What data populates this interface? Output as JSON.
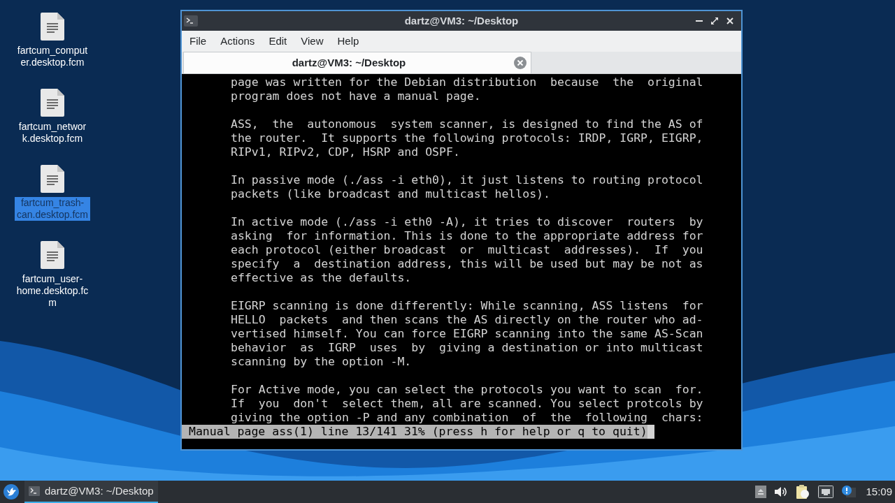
{
  "desktop_icons": [
    {
      "label_lines": [
        "fartcum_comput",
        "er.desktop.fcm"
      ],
      "selected": false
    },
    {
      "label_lines": [
        "fartcum_networ",
        "k.desktop.fcm"
      ],
      "selected": false
    },
    {
      "label_lines": [
        "fartcum_trash-",
        "can.desktop.fcm"
      ],
      "selected": true
    },
    {
      "label_lines": [
        "fartcum_user-",
        "home.desktop.fc",
        "m"
      ],
      "selected": false
    }
  ],
  "window": {
    "title": "dartz@VM3: ~/Desktop",
    "menu": [
      "File",
      "Actions",
      "Edit",
      "View",
      "Help"
    ],
    "tabs": [
      {
        "label": "dartz@VM3: ~/Desktop",
        "selected": true
      }
    ],
    "terminal": {
      "paragraphs": [
        [
          "page was written for the Debian distribution  because  the  original",
          "program does not have a manual page."
        ],
        [
          "ASS,  the  autonomous  system scanner, is designed to find the AS of",
          "the router.  It supports the following protocols: IRDP, IGRP, EIGRP,",
          "RIPv1, RIPv2, CDP, HSRP and OSPF."
        ],
        [
          "In passive mode (./ass -i eth0), it just listens to routing protocol",
          "packets (like broadcast and multicast hellos)."
        ],
        [
          "In active mode (./ass -i eth0 -A), it tries to discover  routers  by",
          "asking  for information. This is done to the appropriate address for",
          "each protocol (either broadcast  or  multicast  addresses).  If  you",
          "specify  a  destination address, this will be used but may be not as",
          "effective as the defaults."
        ],
        [
          "EIGRP scanning is done differently: While scanning, ASS listens  for",
          "HELLO  packets  and then scans the AS directly on the router who ad-",
          "vertised himself. You can force EIGRP scanning into the same AS-Scan",
          "behavior  as  IGRP  uses  by  giving a destination or into multicast",
          "scanning by the option -M."
        ],
        [
          "For Active mode, you can select the protocols you want to scan  for.",
          "If  you  don't  select them, all are scanned. You select protcols by",
          "giving the option -P and any combination  of  the  following  chars:"
        ]
      ],
      "status_line": "Manual page ass(1) line 13/141 31% (press h for help or q to quit)"
    }
  },
  "taskbar": {
    "tasks": [
      {
        "label": "dartz@VM3: ~/Desktop",
        "selected": true
      }
    ],
    "clock": "15:09"
  }
}
